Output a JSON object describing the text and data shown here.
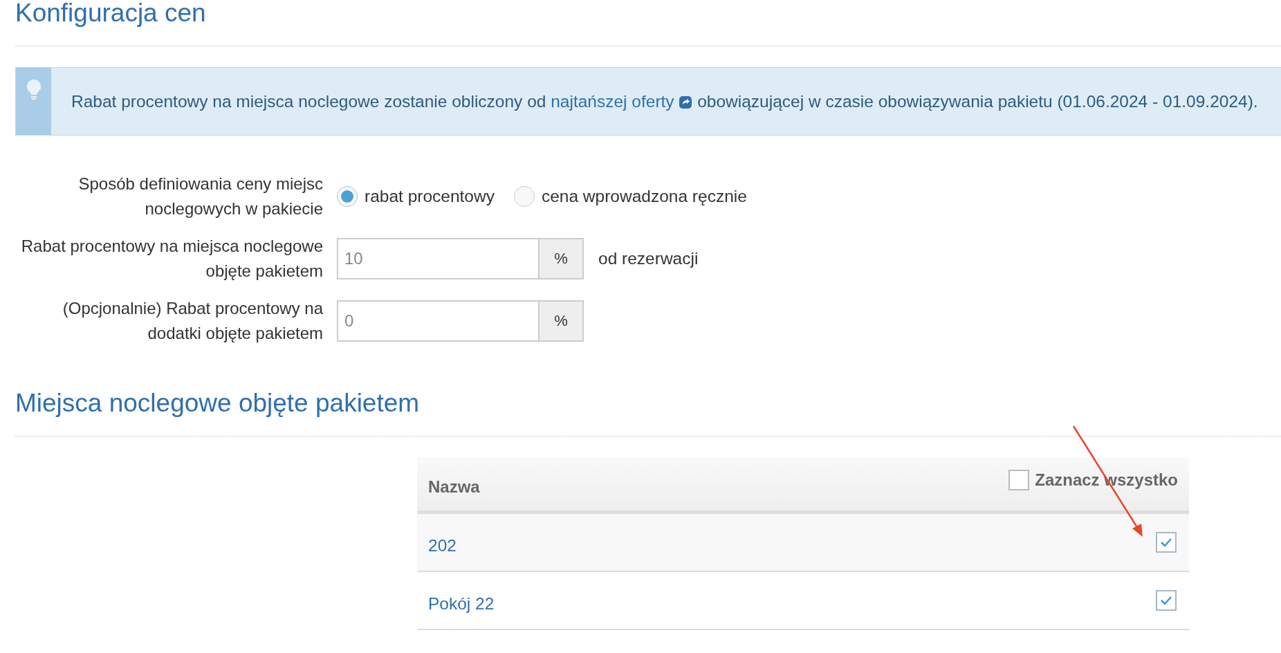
{
  "price_section": {
    "title": "Konfiguracja cen"
  },
  "info_banner": {
    "text_before": "Rabat procentowy na miejsca noclegowe zostanie obliczony od",
    "link": "najtańszej oferty",
    "text_after": "obowiązującej w czasie obowiązywania pakietu (01.06.2024 - 01.09.2024)."
  },
  "form": {
    "pricing_method": {
      "label": "Sposób definiowania ceny miejsc noclegowych w pakiecie",
      "options": [
        {
          "label": "rabat procentowy",
          "selected": true
        },
        {
          "label": "cena wprowadzona ręcznie",
          "selected": false
        }
      ]
    },
    "fields": [
      {
        "label": "Rabat procentowy na miejsca noclegowe objęte pakietem",
        "placeholder": "10",
        "unit": "%",
        "suffix": "od rezerwacji"
      },
      {
        "label": "(Opcjonalnie) Rabat procentowy na dodatki objęte pakietem",
        "placeholder": "0",
        "unit": "%"
      }
    ]
  },
  "rooms_section": {
    "title": "Miejsca noclegowe objęte pakietem",
    "table": {
      "columns": [
        "Nazwa"
      ],
      "select_all": {
        "label": "Zaznacz wszystko",
        "checked": false
      },
      "rows": [
        {
          "name": "202",
          "checked": true
        },
        {
          "name": "Pokój 22",
          "checked": true
        }
      ]
    }
  },
  "annotation": {
    "kind": "arrow"
  }
}
